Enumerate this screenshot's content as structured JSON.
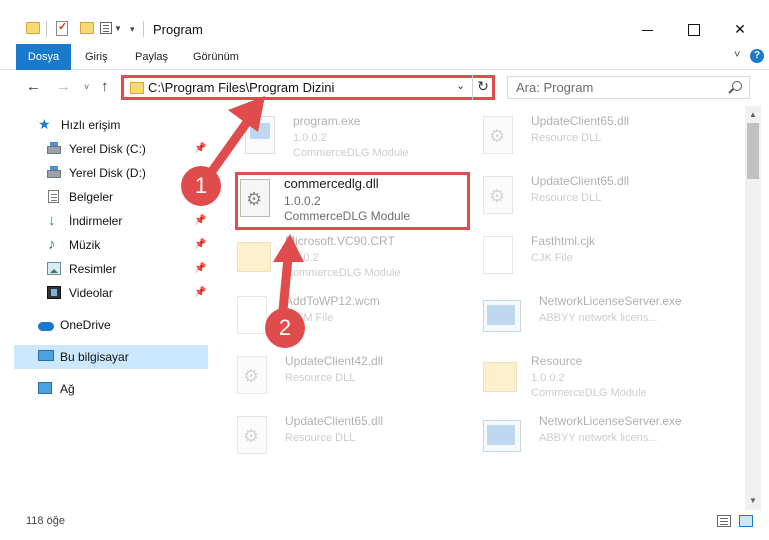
{
  "titlebar": {
    "title": "Program",
    "quick_access": [
      "folder-icon",
      "properties-icon",
      "new-folder-icon",
      "customize-icon"
    ]
  },
  "ribbon": {
    "tabs": [
      {
        "label": "Dosya",
        "active": true
      },
      {
        "label": "Giriş"
      },
      {
        "label": "Paylaş"
      },
      {
        "label": "Görünüm"
      }
    ]
  },
  "nav": {
    "address": "C:\\Program Files\\Program Dizini",
    "search_placeholder": "Ara: Program"
  },
  "sidebar": {
    "items": [
      {
        "label": "Hızlı erişim",
        "icon": "star-icon"
      },
      {
        "label": "Yerel Disk (C:)",
        "icon": "drive-icon",
        "pinned": true
      },
      {
        "label": "Yerel Disk (D:)",
        "icon": "drive-icon"
      },
      {
        "label": "Belgeler",
        "icon": "document-icon",
        "pinned": true
      },
      {
        "label": "İndirmeler",
        "icon": "download-icon",
        "pinned": true
      },
      {
        "label": "Müzik",
        "icon": "music-icon",
        "pinned": true
      },
      {
        "label": "Resimler",
        "icon": "pictures-icon",
        "pinned": true
      },
      {
        "label": "Videolar",
        "icon": "video-icon",
        "pinned": true
      },
      {
        "label": "OneDrive",
        "icon": "cloud-icon"
      },
      {
        "label": "Bu bilgisayar",
        "icon": "pc-icon",
        "selected": true
      },
      {
        "label": "Ağ",
        "icon": "network-icon"
      }
    ]
  },
  "files": [
    {
      "name": "program.exe",
      "line1": "1.0.0.2",
      "line2": "CommerceDLG Module",
      "icon": "exe-icon"
    },
    {
      "name": "UpdateClient65.dll",
      "line1": "Resource DLL",
      "line2": "",
      "icon": "gear-file-icon"
    },
    {
      "name": "commercedlg.dll",
      "line1": "1.0.0.2",
      "line2": "CommerceDLG Module",
      "icon": "gear-file-icon",
      "highlighted": true
    },
    {
      "name": "UpdateClient65.dll",
      "line1": "Resource DLL",
      "line2": "",
      "icon": "gear-file-icon"
    },
    {
      "name": "Microsoft.VC90.CRT",
      "line1": "1.0.0.2",
      "line2": "CommerceDLG Module",
      "icon": "folder-icon"
    },
    {
      "name": "Fasthtml.cjk",
      "line1": "CJK File",
      "line2": "",
      "icon": "blank-file-icon"
    },
    {
      "name": "AddToWP12.wcm",
      "line1": "WCM File",
      "line2": "",
      "icon": "blank-file-icon"
    },
    {
      "name": "NetworkLicenseServer.exe",
      "line1": "ABBYY network licens...",
      "line2": "",
      "icon": "app-icon"
    },
    {
      "name": "UpdateClient42.dll",
      "line1": "Resource DLL",
      "line2": "",
      "icon": "gear-file-icon"
    },
    {
      "name": "Resource",
      "line1": "1.0.0.2",
      "line2": "CommerceDLG Module",
      "icon": "folder-icon"
    },
    {
      "name": "UpdateClient65.dll",
      "line1": "Resource DLL",
      "line2": "",
      "icon": "gear-file-icon"
    },
    {
      "name": "NetworkLicenseServer.exe",
      "line1": "ABBYY network licens...",
      "line2": "",
      "icon": "app-icon"
    }
  ],
  "status": {
    "item_count": "118 öğe"
  },
  "callouts": [
    "1",
    "2"
  ],
  "colors": {
    "accent": "#1979ca",
    "highlight": "#e04b4b",
    "selected_bg": "#cce8ff"
  }
}
